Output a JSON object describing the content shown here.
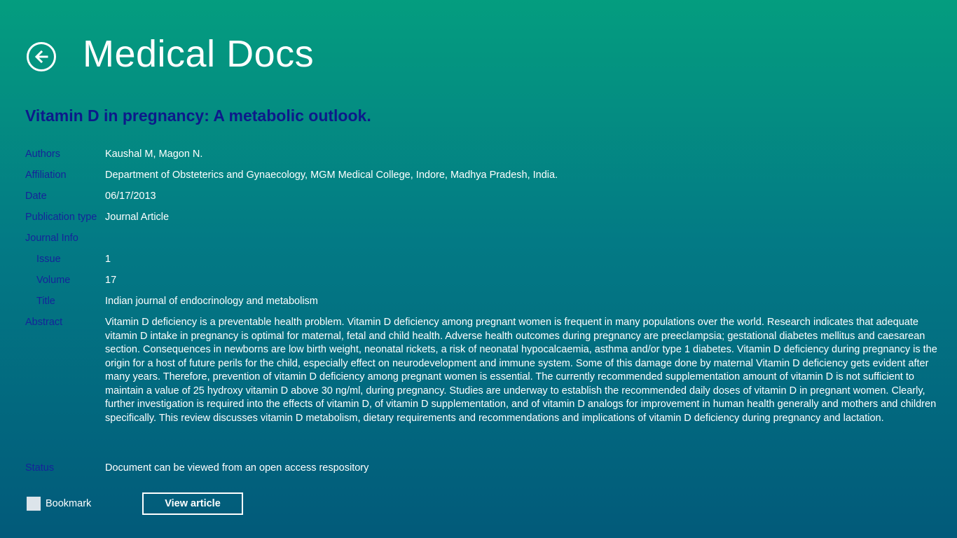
{
  "header": {
    "app_title": "Medical Docs"
  },
  "document": {
    "title": "Vitamin D in pregnancy: A metabolic outlook.",
    "fields": {
      "authors": {
        "label": "Authors",
        "value": "Kaushal M, Magon N."
      },
      "affiliation": {
        "label": "Affiliation",
        "value": "Department of Obsteterics and Gynaecology, MGM Medical College, Indore, Madhya Pradesh, India."
      },
      "date": {
        "label": "Date",
        "value": "06/17/2013"
      },
      "publication_type": {
        "label": "Publication type",
        "value": "Journal Article"
      },
      "journal_info": {
        "label": "Journal Info"
      },
      "issue": {
        "label": "Issue",
        "value": "1"
      },
      "volume": {
        "label": "Volume",
        "value": "17"
      },
      "journal_title": {
        "label": "Title",
        "value": "Indian journal of endocrinology and metabolism"
      },
      "abstract": {
        "label": "Abstract",
        "value": "Vitamin D deficiency is a preventable health problem. Vitamin D deficiency among pregnant women is frequent in many populations over the world. Research indicates that adequate vitamin D intake in pregnancy is optimal for maternal, fetal and child health. Adverse health outcomes during pregnancy are preeclampsia; gestational diabetes mellitus and caesarean section. Consequences in newborns are low birth weight, neonatal rickets, a risk of neonatal hypocalcaemia, asthma and/or type 1 diabetes. Vitamin D deficiency during pregnancy is the origin for a host of future perils for the child, especially effect on neurodevelopment and immune system. Some of this damage done by maternal Vitamin D deficiency gets evident after many years. Therefore, prevention of vitamin D deficiency among pregnant women is essential. The currently recommended supplementation amount of vitamin D is not sufficient to maintain a value of 25 hydroxy vitamin D above 30 ng/ml, during pregnancy. Studies are underway to establish the recommended daily doses of vitamin D in pregnant women. Clearly, further investigation is required into the effects of vitamin D, of vitamin D supplementation, and of vitamin D analogs for improvement in human health generally and mothers and children specifically. This review discusses vitamin D metabolism, dietary requirements and recommendations and implications of vitamin D deficiency during pregnancy and lactation."
      },
      "status": {
        "label": "Status",
        "value": "Document can be viewed from an open access respository"
      }
    }
  },
  "actions": {
    "bookmark_label": "Bookmark",
    "bookmark_checked": false,
    "view_article_label": "View article"
  },
  "colors": {
    "gradient_top": "#049d7f",
    "gradient_bottom": "#025a7a",
    "label": "#15249a",
    "doc_title": "#0d1a8a",
    "text": "#ffffff"
  }
}
